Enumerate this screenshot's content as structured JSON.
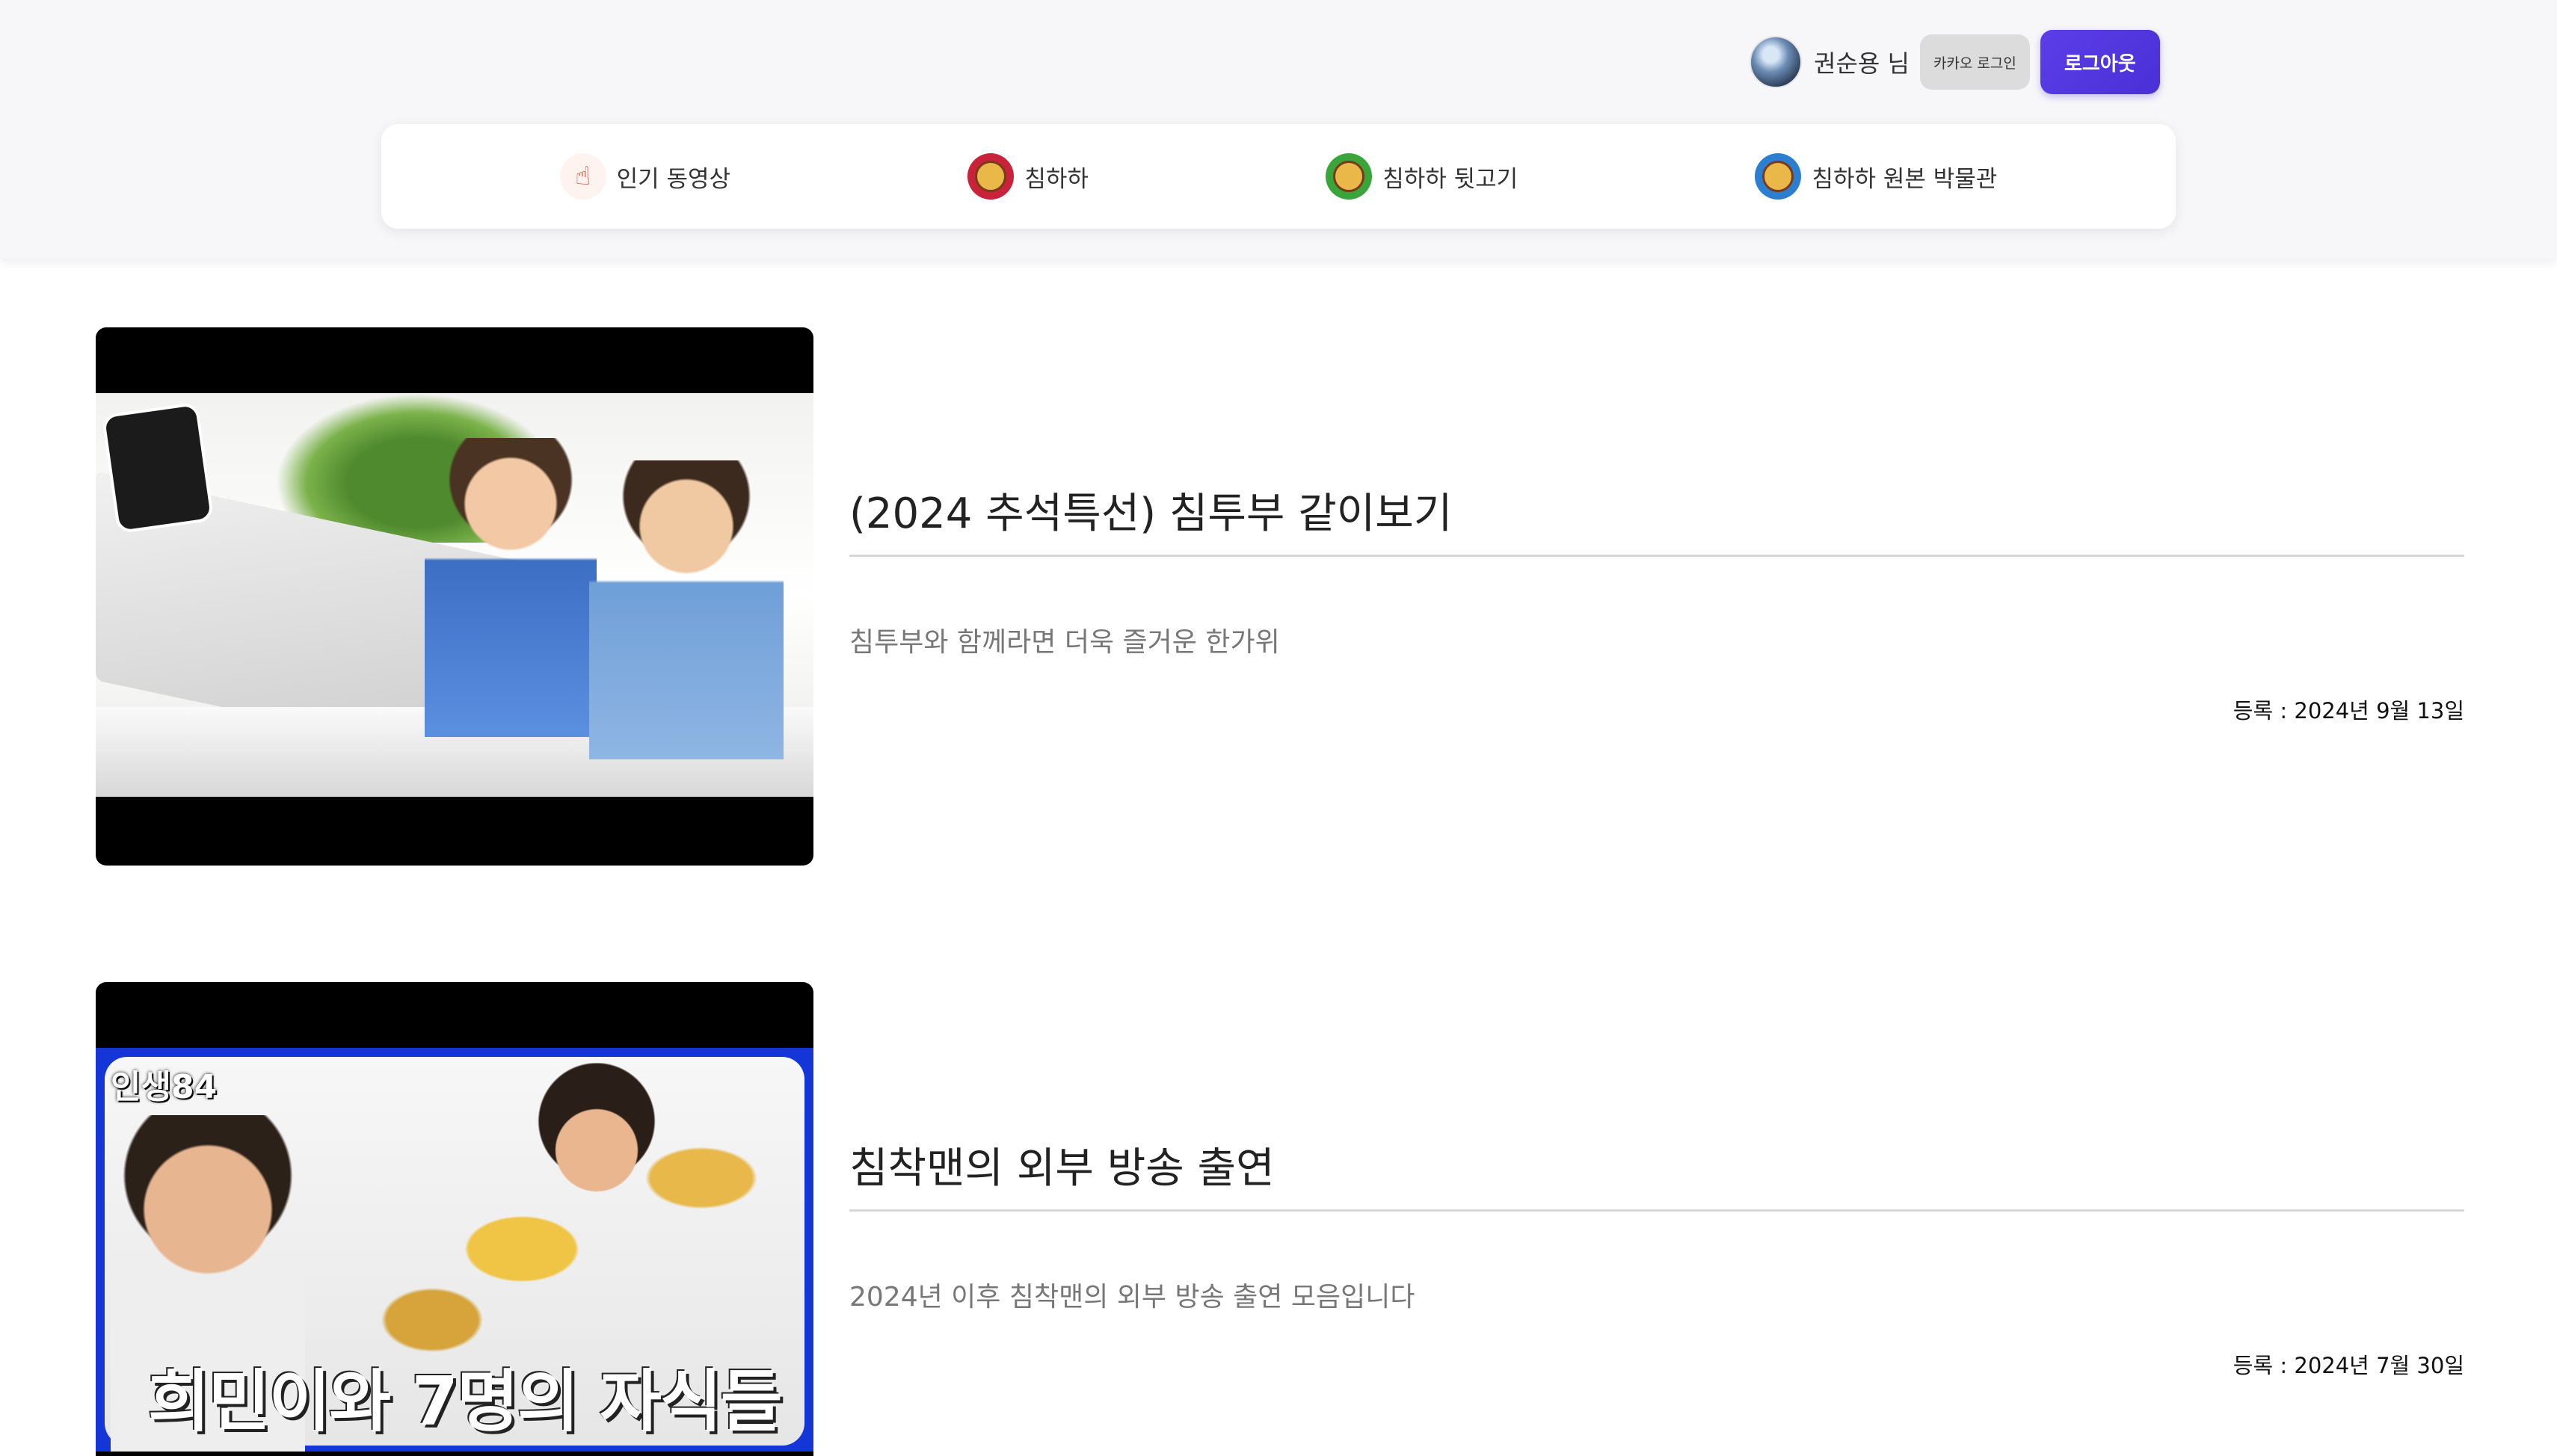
{
  "user": {
    "name": "권순용 님",
    "kakao_label": "카카오 로그인",
    "logout_label": "로그아웃",
    "accent_color": "#4a2fd6"
  },
  "nav": {
    "items": [
      {
        "label": "인기 동영상",
        "icon": "pointing-hand-icon"
      },
      {
        "label": "침하하",
        "icon": "chimhaha-logo-icon"
      },
      {
        "label": "침하하 뒷고기",
        "icon": "chimhaha-backmeat-icon"
      },
      {
        "label": "침하하 원본 박물관",
        "icon": "chimhaha-museum-icon"
      }
    ]
  },
  "posts": [
    {
      "title": "(2024 추석특선) 침투부 같이보기",
      "description": "침투부와 함께라면 더욱 즐거운 한가위",
      "date": "등록 : 2024년 9월 13일"
    },
    {
      "title": "침착맨의 외부 방송 출연",
      "description": "2024년 이후 침착맨의 외부 방송 출연 모음입니다",
      "date": "등록 : 2024년 7월 30일",
      "thumbnail_logo": "인생84",
      "thumbnail_caption": "희민이와 7명의 자식들"
    }
  ]
}
